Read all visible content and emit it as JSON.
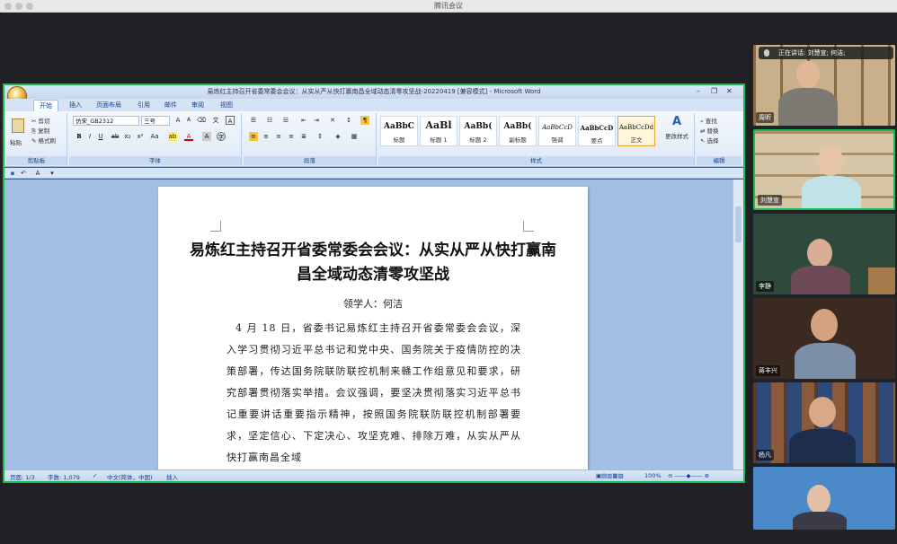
{
  "app": {
    "window_title": "腾讯会议"
  },
  "word": {
    "title": "易炼红主持召开省委常委会会议：从实从严从快打赢南昌全域动态清零攻坚战-20220419 [兼容模式] - Microsoft Word",
    "tabs": [
      "开始",
      "插入",
      "页面布局",
      "引用",
      "邮件",
      "审阅",
      "视图"
    ],
    "clipboard": {
      "paste": "粘贴",
      "cut": "剪切",
      "copy": "复制",
      "format_painter": "格式刷",
      "label": "剪贴板"
    },
    "font": {
      "name": "仿宋_GB2312",
      "size": "三号",
      "label": "字体"
    },
    "paragraph_label": "段落",
    "styles": {
      "label": "样式",
      "items": [
        {
          "sample": "AaBbC",
          "name": "标题"
        },
        {
          "sample": "AaBl",
          "name": "标题 1"
        },
        {
          "sample": "AaBb(",
          "name": "标题 2"
        },
        {
          "sample": "AaBb(",
          "name": "副标题"
        },
        {
          "sample": "AaBbCcD",
          "name": "强调"
        },
        {
          "sample": "AaBbCcD",
          "name": "要点"
        },
        {
          "sample": "AaBbCcDd",
          "name": "正文"
        }
      ],
      "change_styles": "更改样式"
    },
    "editing": {
      "find": "查找",
      "replace": "替换",
      "select": "选择",
      "label": "编辑"
    },
    "document": {
      "title": "易炼红主持召开省委常委会会议：从实从严从快打赢南昌全域动态清零攻坚战",
      "leader": "领学人：何洁",
      "body": "4 月 18 日，省委书记易炼红主持召开省委常委会会议，深入学习贯彻习近平总书记和党中央、国务院关于疫情防控的决策部署，传达国务院联防联控机制来赣工作组意见和要求，研究部署贯彻落实举措。会议强调，要坚决贯彻落实习近平总书记重要讲话重要指示精神，按照国务院联防联控机制部署要求，坚定信心、下定决心、攻坚克难、排除万难，从实从严从快打赢南昌全域"
    },
    "status": {
      "page": "页面: 1/3",
      "words": "字数: 1,079",
      "language": "中文(简体，中国)",
      "mode": "插入",
      "zoom": "100%"
    }
  },
  "meeting": {
    "speaking_label": "正在讲话: 刘慧宣; 何洁;",
    "participants": [
      {
        "name": "周昕"
      },
      {
        "name": "刘慧宣"
      },
      {
        "name": "李静"
      },
      {
        "name": "蒋丰兴"
      },
      {
        "name": "杨凡"
      },
      {
        "name": ""
      }
    ]
  }
}
